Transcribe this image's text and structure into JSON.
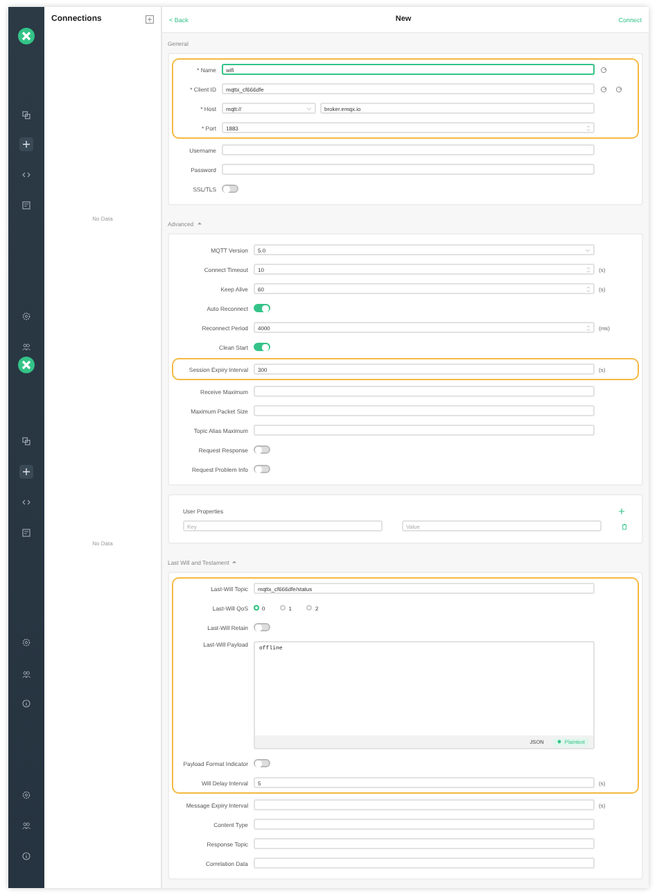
{
  "connections": {
    "title": "Connections",
    "empty_messages": [
      "No Data",
      "No Data"
    ]
  },
  "header": {
    "back": "< Back",
    "title": "New",
    "action": "Connect"
  },
  "sections": [
    {
      "title": "General",
      "cards": [
        {
          "kind": "form",
          "blocks": [
            {
              "highlighted": true,
              "fields": [
                {
                  "kind": "input",
                  "label": "* Name",
                  "value": "wifi",
                  "refresh": true
                },
                {
                  "kind": "input",
                  "label": "* Client ID",
                  "value": "mqttx_cf666dfe",
                  "refresh": true,
                  "outer_icon": true
                },
                {
                  "kind": "host",
                  "label": "* Host",
                  "protocol": "mqtt://",
                  "value": "broker.emqx.io"
                },
                {
                  "kind": "number",
                  "label": "* Port",
                  "value": "1883"
                }
              ]
            },
            {
              "highlighted": false,
              "fields": [
                {
                  "kind": "input",
                  "label": "Username"
                },
                {
                  "kind": "input",
                  "label": "Password"
                },
                {
                  "kind": "toggle",
                  "label": "SSL/TLS",
                  "on": false
                }
              ]
            }
          ]
        }
      ]
    },
    {
      "title": "Advanced",
      "expanded": true,
      "cards": [
        {
          "kind": "form",
          "blocks": [
            {
              "highlighted": false,
              "fields": [
                {
                  "kind": "select",
                  "label": "MQTT Version",
                  "value": "5.0"
                },
                {
                  "kind": "number",
                  "label": "Connect Timeout",
                  "value": "10",
                  "unit": "(s)"
                },
                {
                  "kind": "number",
                  "label": "Keep Alive",
                  "value": "60",
                  "unit": "(s)"
                },
                {
                  "kind": "toggle",
                  "label": "Auto Reconnect",
                  "on": true
                },
                {
                  "kind": "number",
                  "label": "Reconnect Period",
                  "value": "4000",
                  "unit": "(ms)"
                },
                {
                  "kind": "toggle",
                  "label": "Clean Start",
                  "on": true
                }
              ]
            },
            {
              "highlighted": true,
              "fields": [
                {
                  "kind": "input",
                  "label": "Session Expiry Interval",
                  "value": "300",
                  "unit": "(s)"
                }
              ]
            },
            {
              "highlighted": false,
              "fields": [
                {
                  "kind": "input",
                  "label": "Receive Maximum"
                },
                {
                  "kind": "input",
                  "label": "Maximum Packet Size"
                },
                {
                  "kind": "input",
                  "label": "Topic Alias Maximum"
                },
                {
                  "kind": "toggle",
                  "label": "Request Response",
                  "on": false
                },
                {
                  "kind": "toggle",
                  "label": "Request Problem Info",
                  "on": false
                }
              ]
            }
          ]
        },
        {
          "kind": "properties",
          "title": "User Properties",
          "key_placeholder": "Key",
          "value_placeholder": "Value"
        }
      ]
    },
    {
      "title": "Last Will and Testament",
      "expanded": true,
      "cards": [
        {
          "kind": "form",
          "blocks": [
            {
              "highlighted": true,
              "fields": [
                {
                  "kind": "input",
                  "label": "Last-Will Topic",
                  "value": "mqttx_cf666dfe/status"
                },
                {
                  "kind": "radio",
                  "label": "Last-Will QoS",
                  "options": [
                    {
                      "label": "0",
                      "selected": true
                    },
                    {
                      "label": "1",
                      "selected": false
                    },
                    {
                      "label": "2",
                      "selected": false
                    }
                  ]
                },
                {
                  "kind": "toggle",
                  "label": "Last-Will Retain",
                  "on": false
                },
                {
                  "kind": "payload",
                  "label": "Last-Will Payload",
                  "value": "offline",
                  "formats": [
                    {
                      "label": "JSON",
                      "selected": false
                    },
                    {
                      "label": "Plaintext",
                      "selected": true
                    }
                  ]
                },
                {
                  "kind": "toggle",
                  "label": "Payload Format Indicator",
                  "on": false
                },
                {
                  "kind": "input",
                  "label": "Will Delay Interval",
                  "value": "5",
                  "unit": "(s)"
                }
              ]
            },
            {
              "highlighted": false,
              "fields": [
                {
                  "kind": "input",
                  "label": "Message Expiry Interval",
                  "unit": "(s)"
                },
                {
                  "kind": "input",
                  "label": "Content Type"
                },
                {
                  "kind": "input",
                  "label": "Response Topic"
                },
                {
                  "kind": "input",
                  "label": "Correlation Data"
                }
              ]
            }
          ]
        }
      ]
    }
  ]
}
